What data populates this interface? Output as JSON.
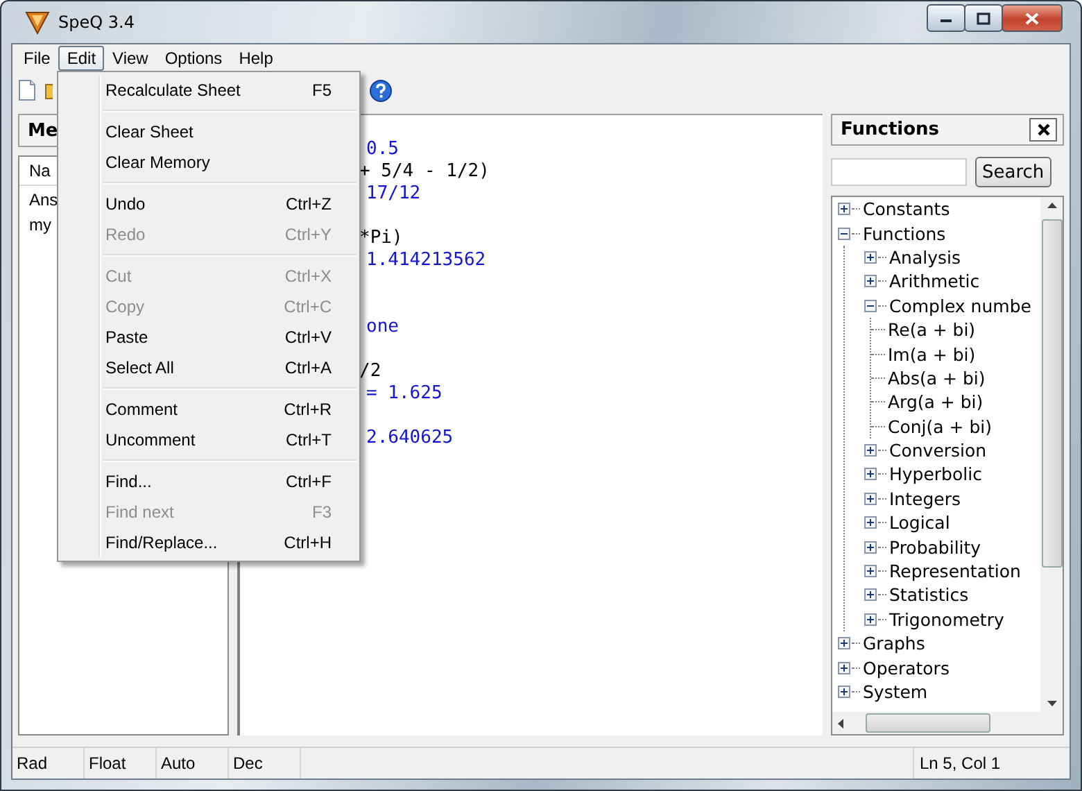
{
  "window": {
    "title": "SpeQ 3.4"
  },
  "menu_bar": [
    {
      "label": "File",
      "selected": false
    },
    {
      "label": "Edit",
      "selected": true
    },
    {
      "label": "View",
      "selected": false
    },
    {
      "label": "Options",
      "selected": false
    },
    {
      "label": "Help",
      "selected": false
    }
  ],
  "edit_menu": {
    "groups": [
      [
        {
          "label": "Recalculate Sheet",
          "shortcut": "F5",
          "disabled": false
        }
      ],
      [
        {
          "label": "Clear Sheet",
          "disabled": false
        },
        {
          "label": "Clear Memory",
          "disabled": false
        }
      ],
      [
        {
          "label": "Undo",
          "shortcut": "Ctrl+Z",
          "disabled": false
        },
        {
          "label": "Redo",
          "shortcut": "Ctrl+Y",
          "disabled": true
        }
      ],
      [
        {
          "label": "Cut",
          "shortcut": "Ctrl+X",
          "disabled": true
        },
        {
          "label": "Copy",
          "shortcut": "Ctrl+C",
          "disabled": true
        },
        {
          "label": "Paste",
          "shortcut": "Ctrl+V",
          "disabled": false
        },
        {
          "label": "Select All",
          "shortcut": "Ctrl+A",
          "disabled": false
        }
      ],
      [
        {
          "label": "Comment",
          "shortcut": "Ctrl+R",
          "disabled": false
        },
        {
          "label": "Uncomment",
          "shortcut": "Ctrl+T",
          "disabled": false
        }
      ],
      [
        {
          "label": "Find...",
          "shortcut": "Ctrl+F",
          "disabled": false
        },
        {
          "label": "Find next",
          "shortcut": "F3",
          "disabled": true
        },
        {
          "label": "Find/Replace...",
          "shortcut": "Ctrl+H",
          "disabled": false
        }
      ]
    ]
  },
  "memory_panel": {
    "title": "Me",
    "column": "Na",
    "items": [
      "Ans",
      "my"
    ]
  },
  "editor": {
    "lines": [
      {
        "kind": "result",
        "text": "0.5"
      },
      {
        "kind": "input",
        "text": "+ 5/4 - 1/2)"
      },
      {
        "kind": "result",
        "text": "17/12"
      },
      {
        "kind": "blank"
      },
      {
        "kind": "input",
        "text": "*Pi)"
      },
      {
        "kind": "result",
        "text": "1.414213562"
      },
      {
        "kind": "blank"
      },
      {
        "kind": "blank"
      },
      {
        "kind": "result",
        "text": "one"
      },
      {
        "kind": "blank"
      },
      {
        "kind": "input",
        "text": "/2"
      },
      {
        "kind": "result",
        "text": "= 1.625"
      },
      {
        "kind": "blank"
      },
      {
        "kind": "result",
        "text": "2.640625"
      }
    ]
  },
  "functions_panel": {
    "title": "Functions",
    "search_button": "Search",
    "tree": [
      {
        "label": "Constants",
        "expanded": false
      },
      {
        "label": "Functions",
        "expanded": true,
        "children": [
          {
            "label": "Analysis",
            "expanded": false
          },
          {
            "label": "Arithmetic",
            "expanded": false
          },
          {
            "label": "Complex numbe",
            "expanded": true,
            "children": [
              {
                "label": "Re(a + bi)"
              },
              {
                "label": "Im(a + bi)"
              },
              {
                "label": "Abs(a + bi)"
              },
              {
                "label": "Arg(a + bi)"
              },
              {
                "label": "Conj(a + bi)"
              }
            ]
          },
          {
            "label": "Conversion",
            "expanded": false
          },
          {
            "label": "Hyperbolic",
            "expanded": false
          },
          {
            "label": "Integers",
            "expanded": false
          },
          {
            "label": "Logical",
            "expanded": false
          },
          {
            "label": "Probability",
            "expanded": false
          },
          {
            "label": "Representation",
            "expanded": false
          },
          {
            "label": "Statistics",
            "expanded": false
          },
          {
            "label": "Trigonometry",
            "expanded": false
          }
        ]
      },
      {
        "label": "Graphs",
        "expanded": false
      },
      {
        "label": "Operators",
        "expanded": false
      },
      {
        "label": "System",
        "expanded": false
      }
    ]
  },
  "status_bar": [
    "Rad",
    "Float",
    "Auto",
    "Dec",
    "Ln 5, Col 1"
  ]
}
